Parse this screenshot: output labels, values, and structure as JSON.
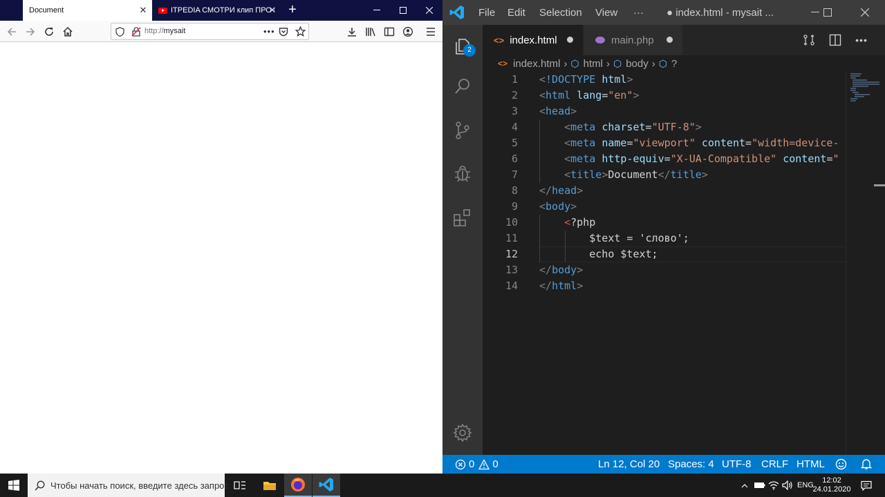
{
  "firefox": {
    "tabs": [
      {
        "label": "Document"
      },
      {
        "label": "ITPEDIA СМОТРИ клип ПРО С..."
      }
    ],
    "url_protocol": "http://",
    "url_host": "mysait",
    "close_glyph": "✕"
  },
  "vscode": {
    "menu": [
      "File",
      "Edit",
      "Selection",
      "View",
      "···"
    ],
    "window_title": "● index.html - mysait ...",
    "badge_count": "2",
    "tabs": [
      {
        "label": "index.html",
        "modified": true
      },
      {
        "label": "main.php",
        "modified": true
      }
    ],
    "breadcrumbs": [
      "index.html",
      "html",
      "body",
      "?"
    ],
    "line_numbers": [
      "1",
      "2",
      "3",
      "4",
      "5",
      "6",
      "7",
      "8",
      "9",
      "10",
      "11",
      "12",
      "13",
      "14"
    ],
    "code_lines": [
      "<!DOCTYPE html>",
      "<html lang=\"en\">",
      "<head>",
      "    <meta charset=\"UTF-8\">",
      "    <meta name=\"viewport\" content=\"width=device-",
      "    <meta http-equiv=\"X-UA-Compatible\" content=\"",
      "    <title>Document</title>",
      "</head>",
      "<body>",
      "    <?php",
      "        $text = 'слово';",
      "        echo $text;",
      "</body>",
      "</html>"
    ],
    "status": {
      "errors": "0",
      "warnings": "0",
      "cursor": "Ln 12, Col 20",
      "spaces": "Spaces: 4",
      "encoding": "UTF-8",
      "eol": "CRLF",
      "language": "HTML"
    }
  },
  "taskbar": {
    "search_placeholder": "Чтобы начать поиск, введите здесь запрос",
    "language": "ENG",
    "time": "12:02",
    "date": "24.01.2020"
  },
  "colors": {
    "firefox_tabbar": "#0f1240",
    "vscode_status": "#007acc",
    "vscode_bg": "#1e1e1e",
    "html_tag": "#569cd6",
    "attr": "#9cdcfe",
    "string": "#ce9178"
  }
}
